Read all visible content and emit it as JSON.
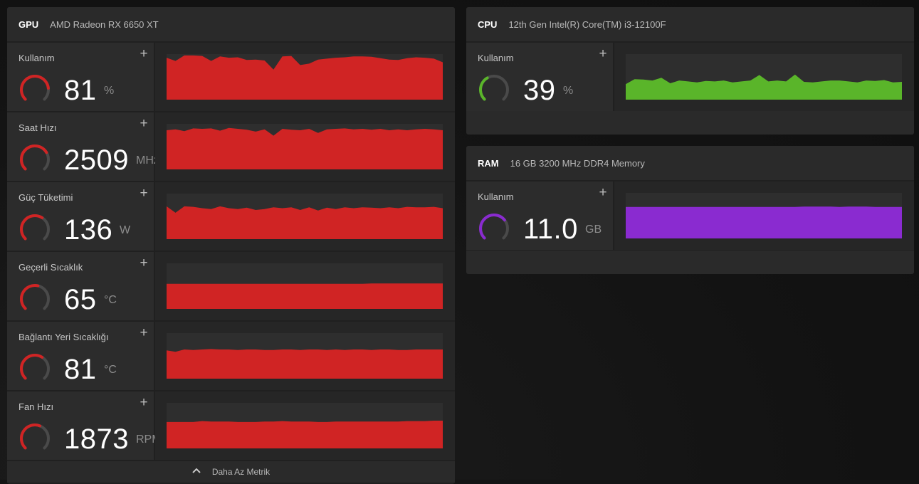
{
  "gpu": {
    "type": "GPU",
    "model": "AMD Radeon RX 6650 XT",
    "color": "#d02424",
    "footer_label": "Daha Az Metrik",
    "metrics": [
      {
        "label": "Kullanım",
        "value": "81",
        "unit": "%",
        "fraction": 0.81,
        "series": [
          0.92,
          0.85,
          0.97,
          0.97,
          0.96,
          0.85,
          0.95,
          0.92,
          0.93,
          0.87,
          0.88,
          0.86,
          0.66,
          0.95,
          0.96,
          0.76,
          0.79,
          0.88,
          0.9,
          0.92,
          0.93,
          0.95,
          0.95,
          0.94,
          0.91,
          0.88,
          0.87,
          0.91,
          0.93,
          0.92,
          0.9,
          0.82
        ]
      },
      {
        "label": "Saat Hızı",
        "value": "2509",
        "unit": "MHz",
        "fraction": 0.72,
        "series": [
          0.86,
          0.88,
          0.84,
          0.9,
          0.89,
          0.9,
          0.85,
          0.91,
          0.89,
          0.87,
          0.83,
          0.88,
          0.74,
          0.89,
          0.87,
          0.86,
          0.89,
          0.8,
          0.88,
          0.89,
          0.9,
          0.88,
          0.89,
          0.87,
          0.89,
          0.86,
          0.88,
          0.86,
          0.88,
          0.89,
          0.88,
          0.86
        ]
      },
      {
        "label": "Güç Tüketimi",
        "value": "136",
        "unit": "W",
        "fraction": 0.62,
        "series": [
          0.72,
          0.58,
          0.72,
          0.71,
          0.68,
          0.66,
          0.72,
          0.68,
          0.66,
          0.69,
          0.64,
          0.66,
          0.7,
          0.68,
          0.7,
          0.64,
          0.7,
          0.63,
          0.69,
          0.66,
          0.7,
          0.68,
          0.7,
          0.69,
          0.68,
          0.7,
          0.68,
          0.71,
          0.7,
          0.7,
          0.71,
          0.68
        ]
      },
      {
        "label": "Geçerli Sıcaklık",
        "value": "65",
        "unit": "°C",
        "fraction": 0.55,
        "series": [
          0.55,
          0.55,
          0.55,
          0.55,
          0.55,
          0.55,
          0.55,
          0.55,
          0.55,
          0.55,
          0.55,
          0.55,
          0.55,
          0.55,
          0.55,
          0.55,
          0.55,
          0.55,
          0.55,
          0.55,
          0.55,
          0.55,
          0.55,
          0.56,
          0.56,
          0.56,
          0.56,
          0.56,
          0.56,
          0.56,
          0.56,
          0.56
        ]
      },
      {
        "label": "Bağlantı Yeri Sıcaklığı",
        "value": "81",
        "unit": "°C",
        "fraction": 0.62,
        "series": [
          0.62,
          0.59,
          0.64,
          0.63,
          0.64,
          0.65,
          0.64,
          0.64,
          0.63,
          0.64,
          0.64,
          0.63,
          0.63,
          0.64,
          0.64,
          0.63,
          0.64,
          0.64,
          0.63,
          0.64,
          0.63,
          0.64,
          0.64,
          0.63,
          0.64,
          0.64,
          0.63,
          0.63,
          0.64,
          0.64,
          0.64,
          0.64
        ]
      },
      {
        "label": "Fan Hızı",
        "value": "1873",
        "unit": "RPM",
        "fraction": 0.58,
        "series": [
          0.58,
          0.58,
          0.58,
          0.58,
          0.6,
          0.59,
          0.59,
          0.59,
          0.58,
          0.58,
          0.58,
          0.59,
          0.59,
          0.6,
          0.59,
          0.59,
          0.59,
          0.58,
          0.58,
          0.59,
          0.59,
          0.59,
          0.59,
          0.59,
          0.59,
          0.59,
          0.59,
          0.6,
          0.6,
          0.6,
          0.61,
          0.61
        ]
      }
    ]
  },
  "cpu": {
    "type": "CPU",
    "model": "12th Gen Intel(R) Core(TM) i3-12100F",
    "color": "#5ab52a",
    "metrics": [
      {
        "label": "Kullanım",
        "value": "39",
        "unit": "%",
        "fraction": 0.39,
        "series": [
          0.34,
          0.45,
          0.44,
          0.42,
          0.48,
          0.36,
          0.42,
          0.4,
          0.38,
          0.41,
          0.4,
          0.42,
          0.38,
          0.4,
          0.42,
          0.54,
          0.4,
          0.42,
          0.4,
          0.55,
          0.39,
          0.38,
          0.4,
          0.42,
          0.42,
          0.4,
          0.38,
          0.42,
          0.41,
          0.43,
          0.38,
          0.39
        ]
      }
    ]
  },
  "ram": {
    "type": "RAM",
    "model": "16 GB 3200 MHz DDR4 Memory",
    "color": "#8a2bd0",
    "metrics": [
      {
        "label": "Kullanım",
        "value": "11.0",
        "unit": "GB",
        "fraction": 0.69,
        "series": [
          0.69,
          0.69,
          0.69,
          0.69,
          0.69,
          0.69,
          0.69,
          0.69,
          0.69,
          0.69,
          0.69,
          0.69,
          0.69,
          0.69,
          0.69,
          0.69,
          0.69,
          0.69,
          0.69,
          0.69,
          0.7,
          0.7,
          0.7,
          0.7,
          0.69,
          0.7,
          0.7,
          0.7,
          0.69,
          0.69,
          0.69,
          0.69
        ]
      }
    ]
  }
}
